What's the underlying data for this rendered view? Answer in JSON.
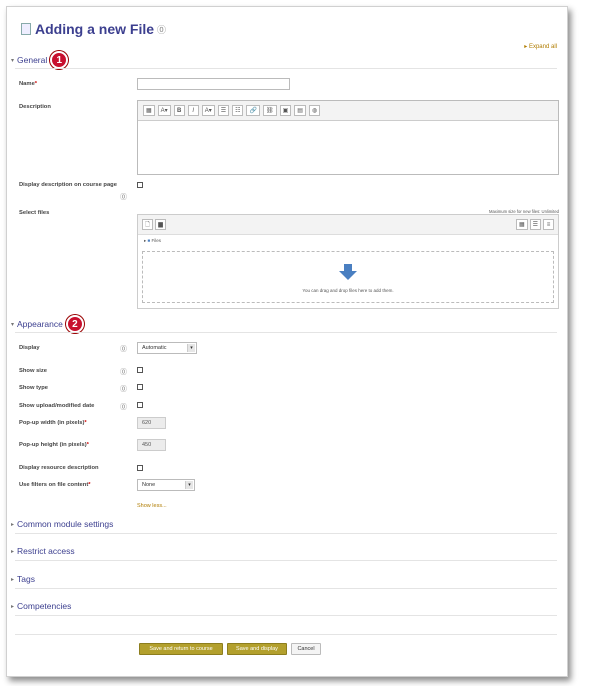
{
  "page": {
    "title": "Adding a new File",
    "expand_all": "Expand all"
  },
  "general": {
    "section_label": "General",
    "badge": "1",
    "name_label": "Name",
    "name_value": "",
    "description_label": "Description",
    "display_on_course_label": "Display description on course page",
    "select_files_label": "Select files",
    "max_size": "Maximum size for new files: Unlimited",
    "files_folder": "Files",
    "drop_text": "You can drag and drop files here to add them."
  },
  "editor": {
    "toolbar": [
      "▦",
      "A▾",
      "B",
      "I",
      "A▾",
      "☰",
      "☷",
      "🔗",
      "⛓",
      "▣",
      "▤",
      "◍"
    ]
  },
  "appearance": {
    "section_label": "Appearance",
    "badge": "2",
    "display_label": "Display",
    "display_value": "Automatic",
    "show_size_label": "Show size",
    "show_type_label": "Show type",
    "show_date_label": "Show upload/modified date",
    "popup_width_label": "Pop-up width (in pixels)",
    "popup_width_value": "620",
    "popup_height_label": "Pop-up height (in pixels)",
    "popup_height_value": "450",
    "display_resource_desc_label": "Display resource description",
    "filters_label": "Use filters on file content",
    "filters_value": "None",
    "show_less": "Show less..."
  },
  "collapsed_sections": [
    "Common module settings",
    "Restrict access",
    "Tags",
    "Competencies"
  ],
  "buttons": {
    "save_return": "Save and return to course",
    "save_display": "Save and display",
    "cancel": "Cancel"
  },
  "colors": {
    "accent": "#3c3f8f",
    "primary_button": "#b3a02d",
    "badge": "#c8102e",
    "link": "#b07c00"
  }
}
